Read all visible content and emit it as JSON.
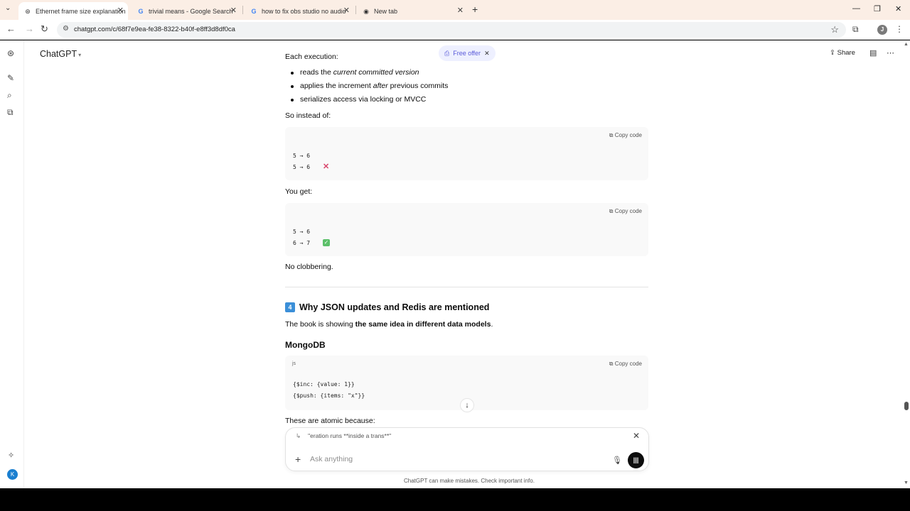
{
  "browser": {
    "tabs": [
      {
        "title": "Ethernet frame size explanation",
        "favicon": "chatgpt-icon"
      },
      {
        "title": "trivial means - Google Search",
        "favicon": "google-icon"
      },
      {
        "title": "how to fix obs studio no audio",
        "favicon": "google-icon"
      },
      {
        "title": "New tab",
        "favicon": "chrome-icon"
      }
    ],
    "url": "chatgpt.com/c/68f7e9ea-fe38-8322-b40f-e8ff3d8df0ca",
    "profile_initial": "J"
  },
  "app": {
    "model_label": "ChatGPT",
    "free_offer": "Free offer",
    "share_label": "Share",
    "user_initial": "K"
  },
  "content": {
    "each_execution": "Each execution:",
    "bullets": [
      {
        "pre": "reads the ",
        "em": "current committed version",
        "post": ""
      },
      {
        "pre": "applies the increment ",
        "em": "after",
        "post": " previous commits"
      },
      {
        "pre": "serializes access via locking or MVCC",
        "em": "",
        "post": ""
      }
    ],
    "so_instead": "So instead of:",
    "copy_code": "Copy code",
    "code1": [
      "5 → 6",
      "5 → 6"
    ],
    "you_get": "You get:",
    "code2": [
      "5 → 6",
      "6 → 7"
    ],
    "no_clobbering": "No clobbering.",
    "heading_num": "4",
    "heading": "Why JSON updates and Redis are mentioned",
    "book_pre": "The book is showing ",
    "book_bold": "the same idea in different data models",
    "book_post": ".",
    "mongodb": "MongoDB",
    "code3_lang": "js",
    "code3": [
      "{$inc: {value: 1}}",
      "{$push: {items: \"x\"}}"
    ],
    "atomic": "These are atomic because:"
  },
  "composer": {
    "quote": "\"eration runs **inside a trans**\"",
    "placeholder": "Ask anything",
    "disclaimer": "ChatGPT can make mistakes. Check important info."
  },
  "colors": {
    "accent_offer": "#5a5ad9",
    "cross_red": "#d8456b",
    "check_green": "#5cc06a",
    "heading_badge": "#3b8fd8"
  }
}
